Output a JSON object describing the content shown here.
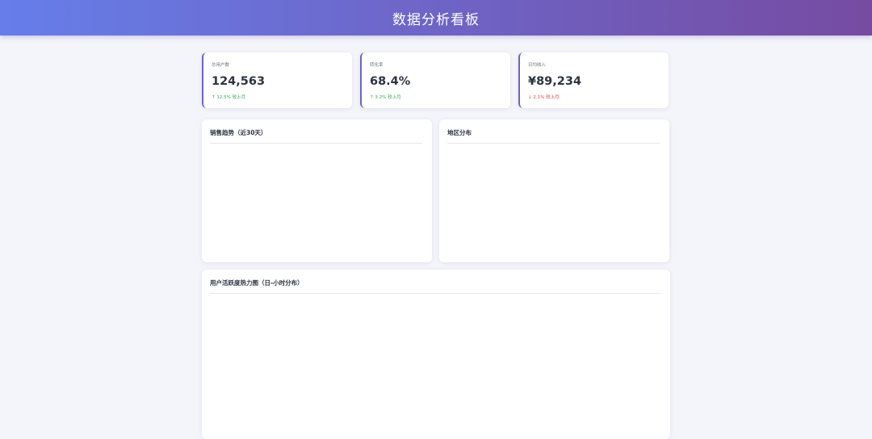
{
  "header": {
    "title": "数据分析看板"
  },
  "stats": [
    {
      "label": "总用户数",
      "value": "124,563",
      "change": "↑ 12.5% 较上月",
      "direction": "up"
    },
    {
      "label": "转化率",
      "value": "68.4%",
      "change": "↑ 3.2% 较上月",
      "direction": "up"
    },
    {
      "label": "日均收入",
      "value": "¥89,234",
      "change": "↓ 2.1% 较上月",
      "direction": "down"
    }
  ],
  "charts": {
    "sales_trend": {
      "title": "销售趋势（近30天）"
    },
    "region": {
      "title": "地区分布"
    },
    "heatmap": {
      "title": "用户活跃度热力图（日-小时分布）"
    }
  },
  "colors": {
    "header_gradient_start": "#667eea",
    "header_gradient_end": "#764ba2",
    "accent": "#6f63c9",
    "up": "#34a853",
    "down": "#e53e3e"
  }
}
